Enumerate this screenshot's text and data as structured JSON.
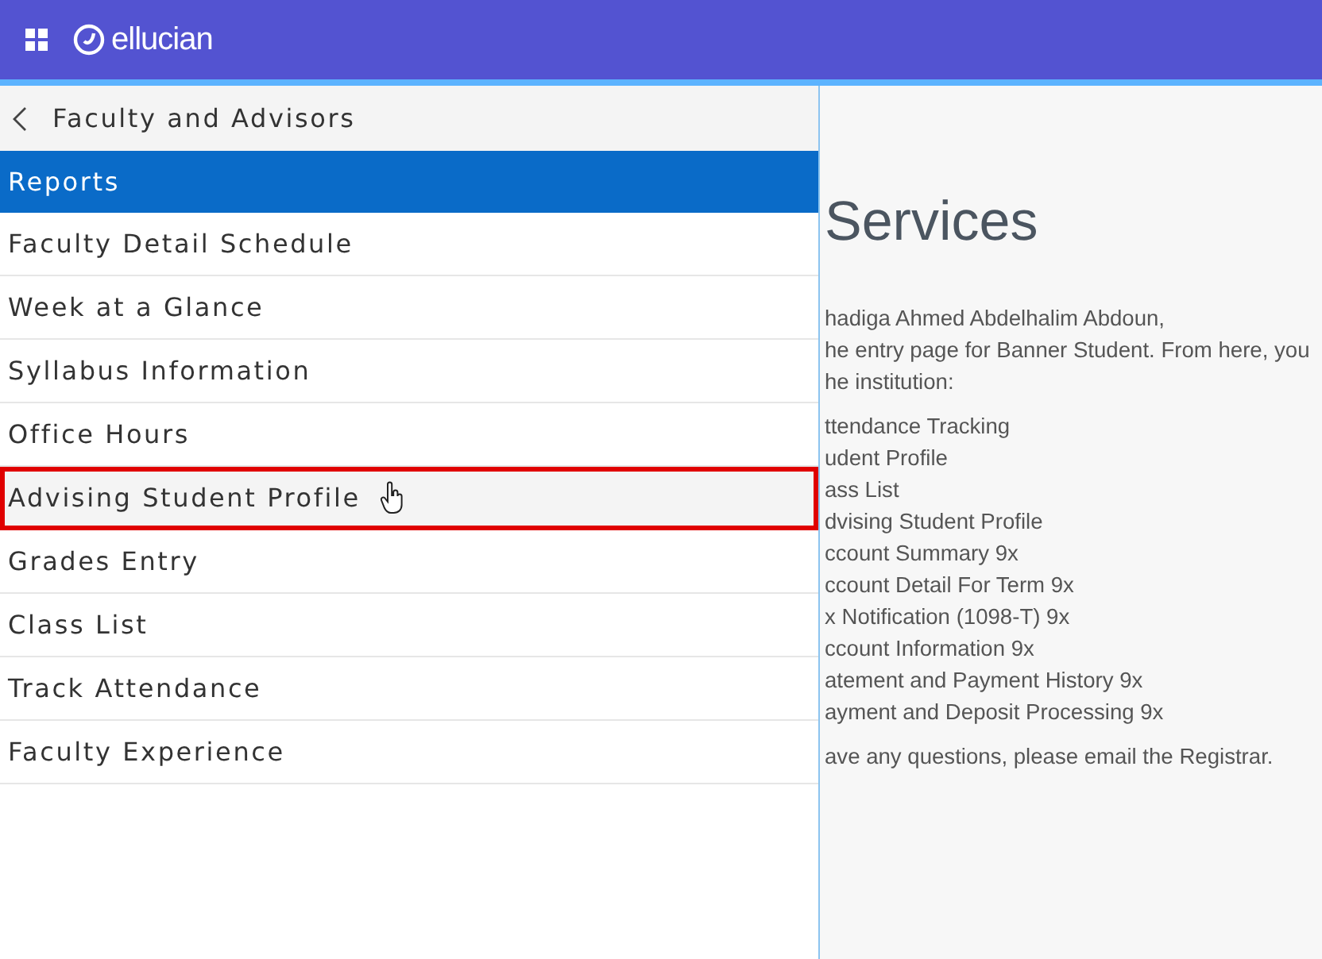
{
  "app_bar": {
    "logo_text": "ellucian"
  },
  "menu": {
    "back_title": "Faculty and Advisors",
    "section": "Reports",
    "items": [
      {
        "label": "Faculty Detail Schedule",
        "selected": false,
        "highlighted": false
      },
      {
        "label": "Week at a Glance",
        "selected": false,
        "highlighted": false
      },
      {
        "label": "Syllabus Information",
        "selected": false,
        "highlighted": false
      },
      {
        "label": "Office Hours",
        "selected": false,
        "highlighted": false
      },
      {
        "label": "Advising Student Profile",
        "selected": true,
        "highlighted": true
      },
      {
        "label": "Grades Entry",
        "selected": false,
        "highlighted": false
      },
      {
        "label": "Class List",
        "selected": false,
        "highlighted": false
      },
      {
        "label": "Track Attendance",
        "selected": false,
        "highlighted": false
      },
      {
        "label": "Faculty Experience",
        "selected": false,
        "highlighted": false
      }
    ]
  },
  "page": {
    "heading": "Services",
    "intro_lines": [
      "hadiga Ahmed Abdelhalim Abdoun,",
      "he entry page for Banner Student. From here, you",
      "he institution:"
    ],
    "links": [
      "ttendance Tracking",
      "udent Profile",
      "ass List",
      "dvising Student Profile",
      "ccount Summary 9x",
      "ccount Detail For Term 9x",
      "x Notification (1098-T) 9x",
      "ccount Information 9x",
      "atement and Payment History 9x",
      "ayment and Deposit Processing 9x"
    ],
    "footer": "ave any questions, please email the Registrar."
  }
}
